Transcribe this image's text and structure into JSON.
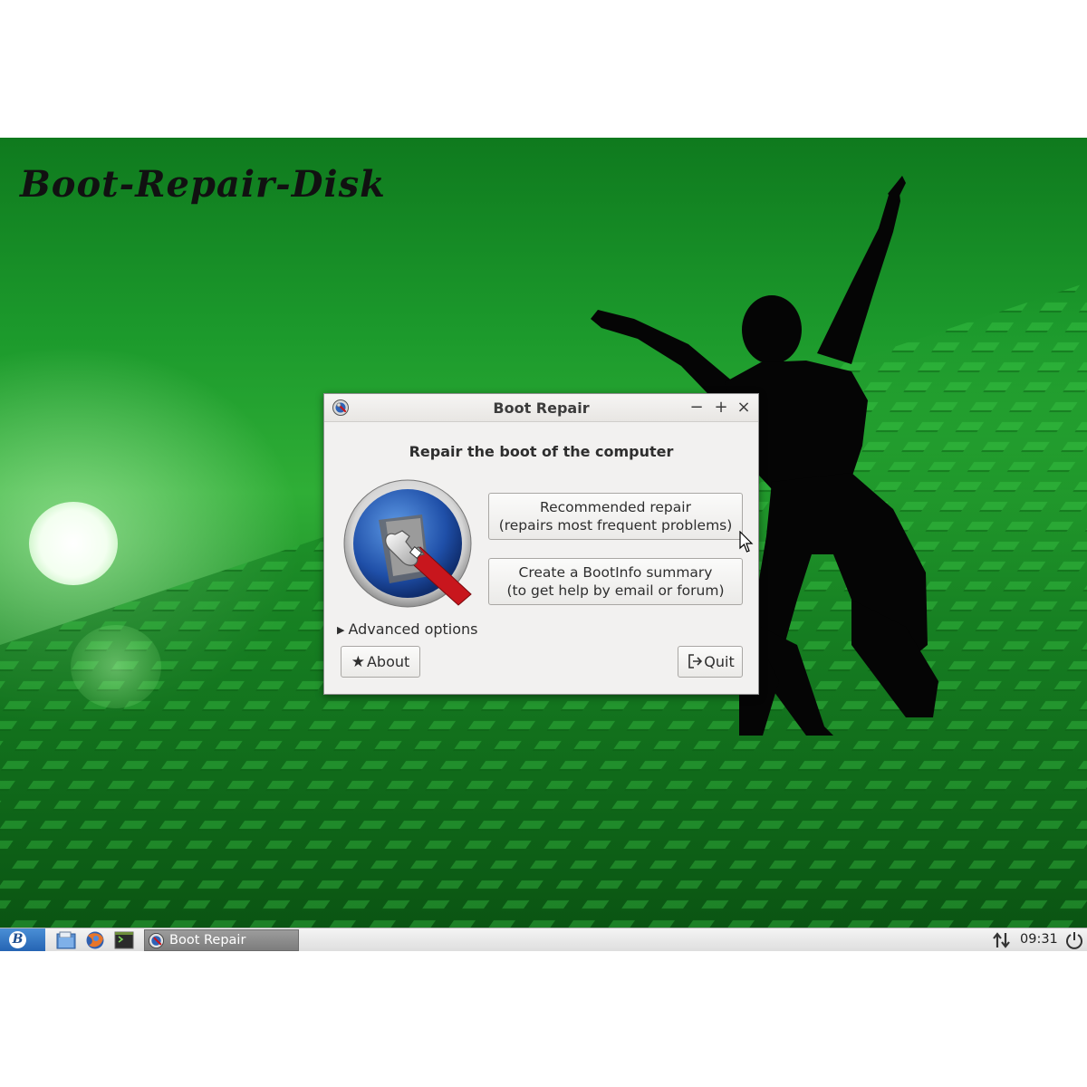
{
  "wallpaper": {
    "title": "Boot-Repair-Disk"
  },
  "window": {
    "title": "Boot Repair",
    "controls": {
      "minimize": "−",
      "maximize": "+",
      "close": "×"
    },
    "heading": "Repair the boot of the computer",
    "recommended_button": {
      "line1": "Recommended repair",
      "line2": "(repairs most frequent problems)"
    },
    "bootinfo_button": {
      "line1": "Create a BootInfo summary",
      "line2": "(to get help by email or forum)"
    },
    "advanced_options": "Advanced options",
    "about_button": "About",
    "quit_button": "Quit"
  },
  "taskbar": {
    "start_icon": "boot-repair-disk-logo-icon",
    "launchers": [
      "file-manager-icon",
      "web-browser-icon",
      "terminal-icon"
    ],
    "task_label": "Boot Repair",
    "clock": "09:31"
  },
  "colors": {
    "wallpaper_green": "#1c9a2c",
    "window_bg": "#f2f1f0",
    "taskbar_bg": "#e6e6e6",
    "task_active_bg": "#8c8c8c",
    "start_button_blue": "#2f74c4",
    "wrench_red": "#c8161d"
  }
}
